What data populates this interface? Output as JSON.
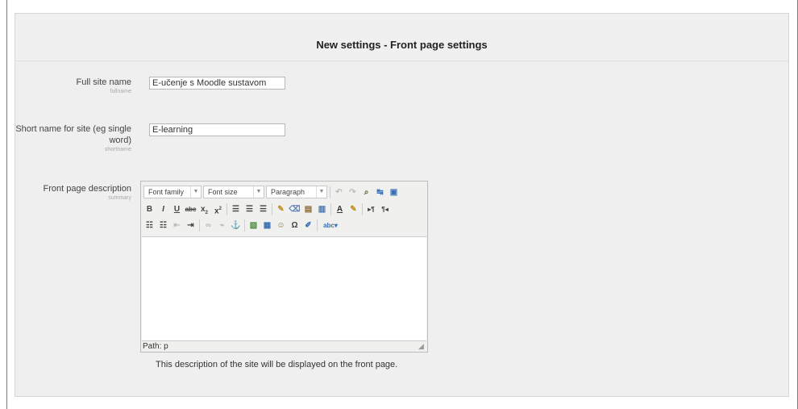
{
  "panel": {
    "title": "New settings - Front page settings"
  },
  "fields": {
    "fullname": {
      "label": "Full site name",
      "key": "fullname",
      "value": "E-učenje s Moodle sustavom"
    },
    "shortname": {
      "label": "Short name for site (eg single word)",
      "key": "shortname",
      "value": "E-learning"
    },
    "summary": {
      "label": "Front page description",
      "key": "summary"
    }
  },
  "editor": {
    "font_family": "Font family",
    "font_size": "Font size",
    "format": "Paragraph",
    "path": "Path: p",
    "row1_icons": [
      "undo-icon",
      "redo-icon",
      "find-icon",
      "replace-icon",
      "fullscreen-icon"
    ],
    "row2_icons": [
      "bold-icon",
      "italic-icon",
      "underline-icon",
      "strikethrough-icon",
      "subscript-icon",
      "superscript-icon",
      "align-left-icon",
      "align-center-icon",
      "align-right-icon",
      "clean-up-icon",
      "remove-format-icon",
      "paste-text-icon",
      "paste-word-icon",
      "text-color-icon",
      "background-color-icon",
      "ltr-icon",
      "rtl-icon"
    ],
    "row3_icons": [
      "bullet-list-icon",
      "numbered-list-icon",
      "outdent-icon",
      "indent-icon",
      "link-icon",
      "unlink-icon",
      "anchor-icon",
      "image-icon",
      "media-icon",
      "emoticons-icon",
      "special-char-icon",
      "edit-html-icon",
      "spellcheck-icon"
    ]
  },
  "help": "This description of the site will be displayed on the front page."
}
